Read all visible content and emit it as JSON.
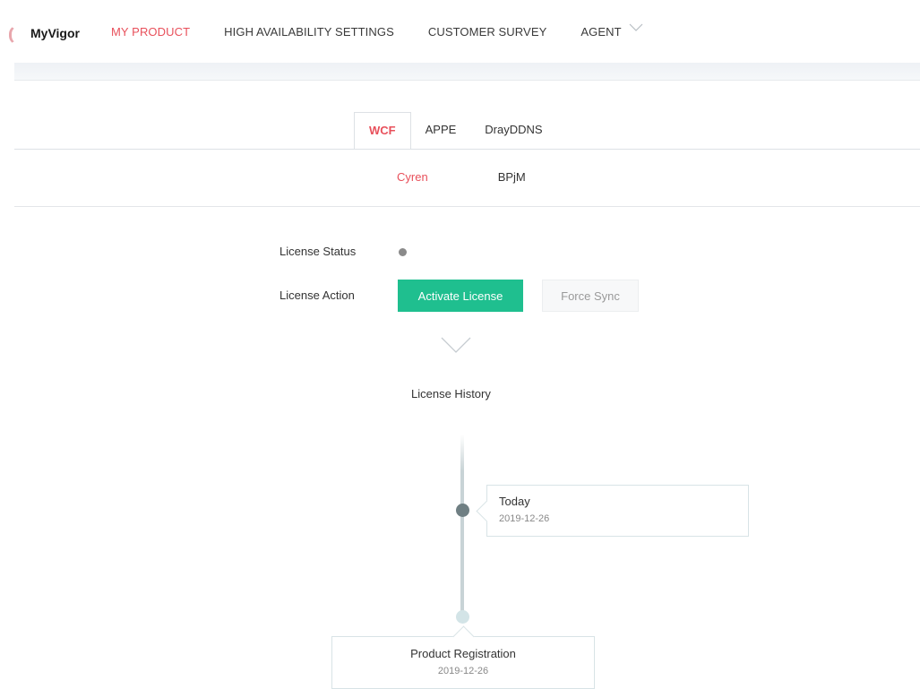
{
  "brand": {
    "name": "MyVigor"
  },
  "nav": {
    "items": [
      {
        "label": "MY PRODUCT",
        "active": true
      },
      {
        "label": "HIGH AVAILABILITY SETTINGS",
        "active": false
      },
      {
        "label": "CUSTOMER SURVEY",
        "active": false
      },
      {
        "label": "AGENT",
        "active": false
      }
    ],
    "more_icon": "chevron-down-icon"
  },
  "tabs": [
    {
      "label": "WCF",
      "active": true
    },
    {
      "label": "APPE",
      "active": false
    },
    {
      "label": "DrayDDNS",
      "active": false
    }
  ],
  "subtabs": [
    {
      "label": "Cyren",
      "active": true
    },
    {
      "label": "BPjM",
      "active": false
    }
  ],
  "license": {
    "status_label": "License Status",
    "status_color": "#8a8a8a",
    "action_label": "License Action",
    "activate_label": "Activate License",
    "sync_label": "Force Sync",
    "expand_icon": "chevron-down-icon",
    "history_title": "License History"
  },
  "history": [
    {
      "title": "Today",
      "date": "2019-12-26"
    },
    {
      "title": "Product Registration",
      "date": "2019-12-26"
    }
  ],
  "colors": {
    "accent": "#e8505b",
    "primary_button": "#1fbf8f"
  }
}
